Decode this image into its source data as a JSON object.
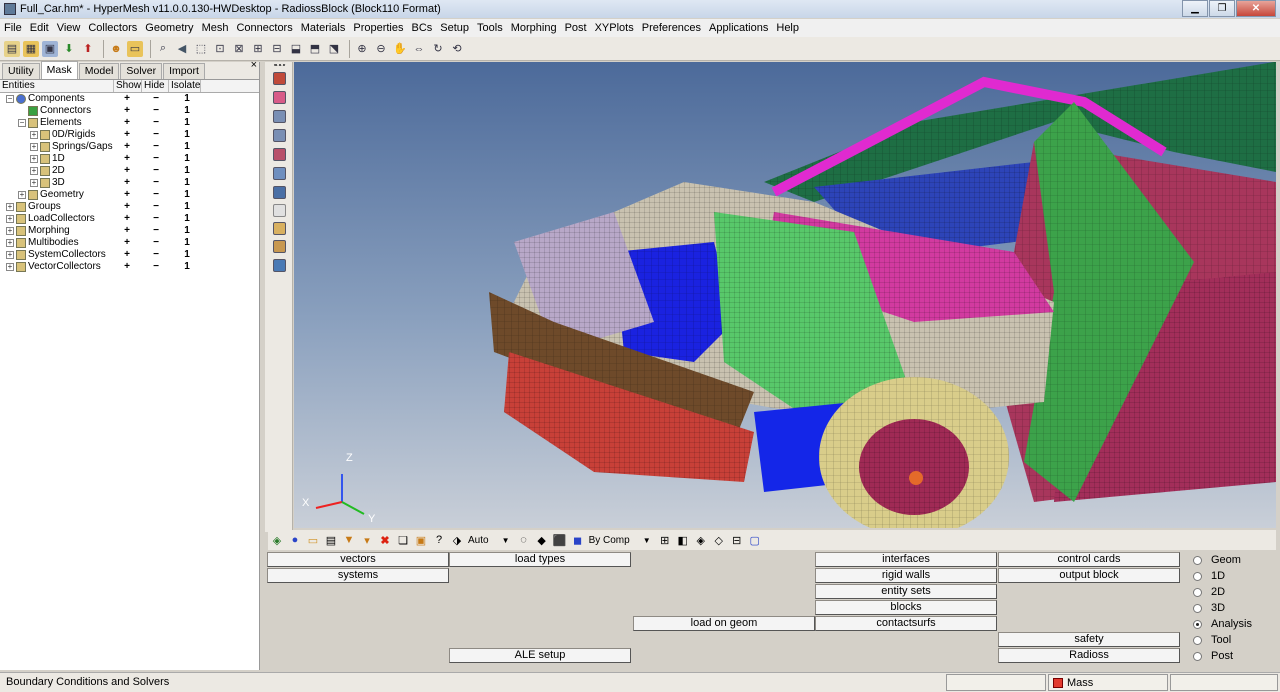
{
  "window": {
    "title": "Full_Car.hm* - HyperMesh v11.0.0.130-HWDesktop - RadiossBlock (Block110 Format)"
  },
  "menu": [
    "File",
    "Edit",
    "View",
    "Collectors",
    "Geometry",
    "Mesh",
    "Connectors",
    "Materials",
    "Properties",
    "BCs",
    "Setup",
    "Tools",
    "Morphing",
    "Post",
    "XYPlots",
    "Preferences",
    "Applications",
    "Help"
  ],
  "panel_tabs": [
    "Utility",
    "Mask",
    "Model",
    "Solver",
    "Import"
  ],
  "active_tab": "Mask",
  "tree": {
    "headers": [
      "Entities",
      "Show",
      "Hide",
      "Isolate"
    ],
    "plus": "+",
    "minus": "−",
    "one": "1",
    "rows": [
      {
        "label": "Components",
        "level": 0
      },
      {
        "label": "Connectors",
        "level": 1
      },
      {
        "label": "Elements",
        "level": 1
      },
      {
        "label": "0D/Rigids",
        "level": 2
      },
      {
        "label": "Springs/Gaps",
        "level": 2
      },
      {
        "label": "1D",
        "level": 2
      },
      {
        "label": "2D",
        "level": 2
      },
      {
        "label": "3D",
        "level": 2
      },
      {
        "label": "Geometry",
        "level": 1
      },
      {
        "label": "Groups",
        "level": 0
      },
      {
        "label": "LoadCollectors",
        "level": 0
      },
      {
        "label": "Morphing",
        "level": 0
      },
      {
        "label": "Multibodies",
        "level": 0
      },
      {
        "label": "SystemCollectors",
        "level": 0
      },
      {
        "label": "VectorCollectors",
        "level": 0
      }
    ]
  },
  "viewport": {
    "axes": {
      "z": "Z",
      "x": "X",
      "y": "Y"
    }
  },
  "bottom_toolbar": {
    "auto_label": "Auto",
    "bycomp_label": "By Comp"
  },
  "buttons": {
    "vectors": "vectors",
    "systems": "systems",
    "load_types": "load types",
    "interfaces": "interfaces",
    "rigid_walls": "rigid walls",
    "entity_sets": "entity sets",
    "blocks": "blocks",
    "contactsurfs": "contactsurfs",
    "load_on_geom": "load on geom",
    "ale_setup": "ALE setup",
    "control_cards": "control cards",
    "output_block": "output block",
    "safety": "safety",
    "radioss": "Radioss"
  },
  "radios": [
    {
      "label": "Geom",
      "checked": false
    },
    {
      "label": "1D",
      "checked": false
    },
    {
      "label": "2D",
      "checked": false
    },
    {
      "label": "3D",
      "checked": false
    },
    {
      "label": "Analysis",
      "checked": true
    },
    {
      "label": "Tool",
      "checked": false
    },
    {
      "label": "Post",
      "checked": false
    }
  ],
  "status": {
    "text": "Boundary Conditions and Solvers",
    "mass": "Mass"
  },
  "colors": {
    "mass_swatch": "#e23a2e",
    "viewport_top": "#4c6a9a"
  }
}
